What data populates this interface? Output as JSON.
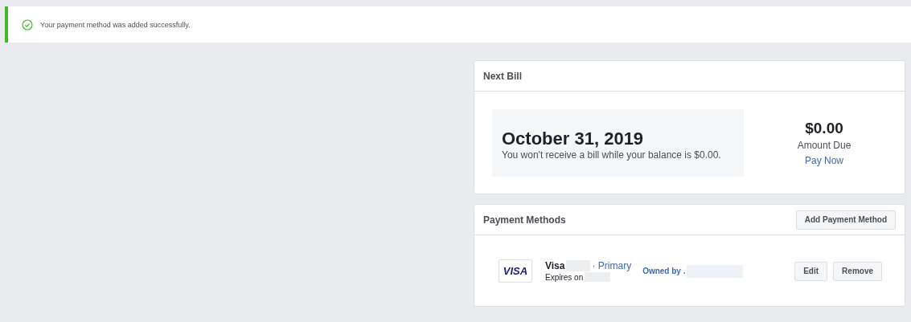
{
  "notice": {
    "message": "Your payment method was added successfully."
  },
  "next_bill": {
    "title": "Next Bill",
    "date": "October 31, 2019",
    "note": "You won't receive a bill while your balance is $0.00.",
    "amount": "$0.00",
    "amount_label": "Amount Due",
    "pay_link": "Pay Now"
  },
  "payment_methods": {
    "title": "Payment Methods",
    "add_button": "Add Payment Method",
    "methods": [
      {
        "card_logo": "VISA",
        "name": "Visa",
        "primary_label": "· Primary",
        "expires_label": "Expires on",
        "owner_label": "Owned by .",
        "actions": [
          "Edit",
          "Remove"
        ]
      }
    ]
  }
}
